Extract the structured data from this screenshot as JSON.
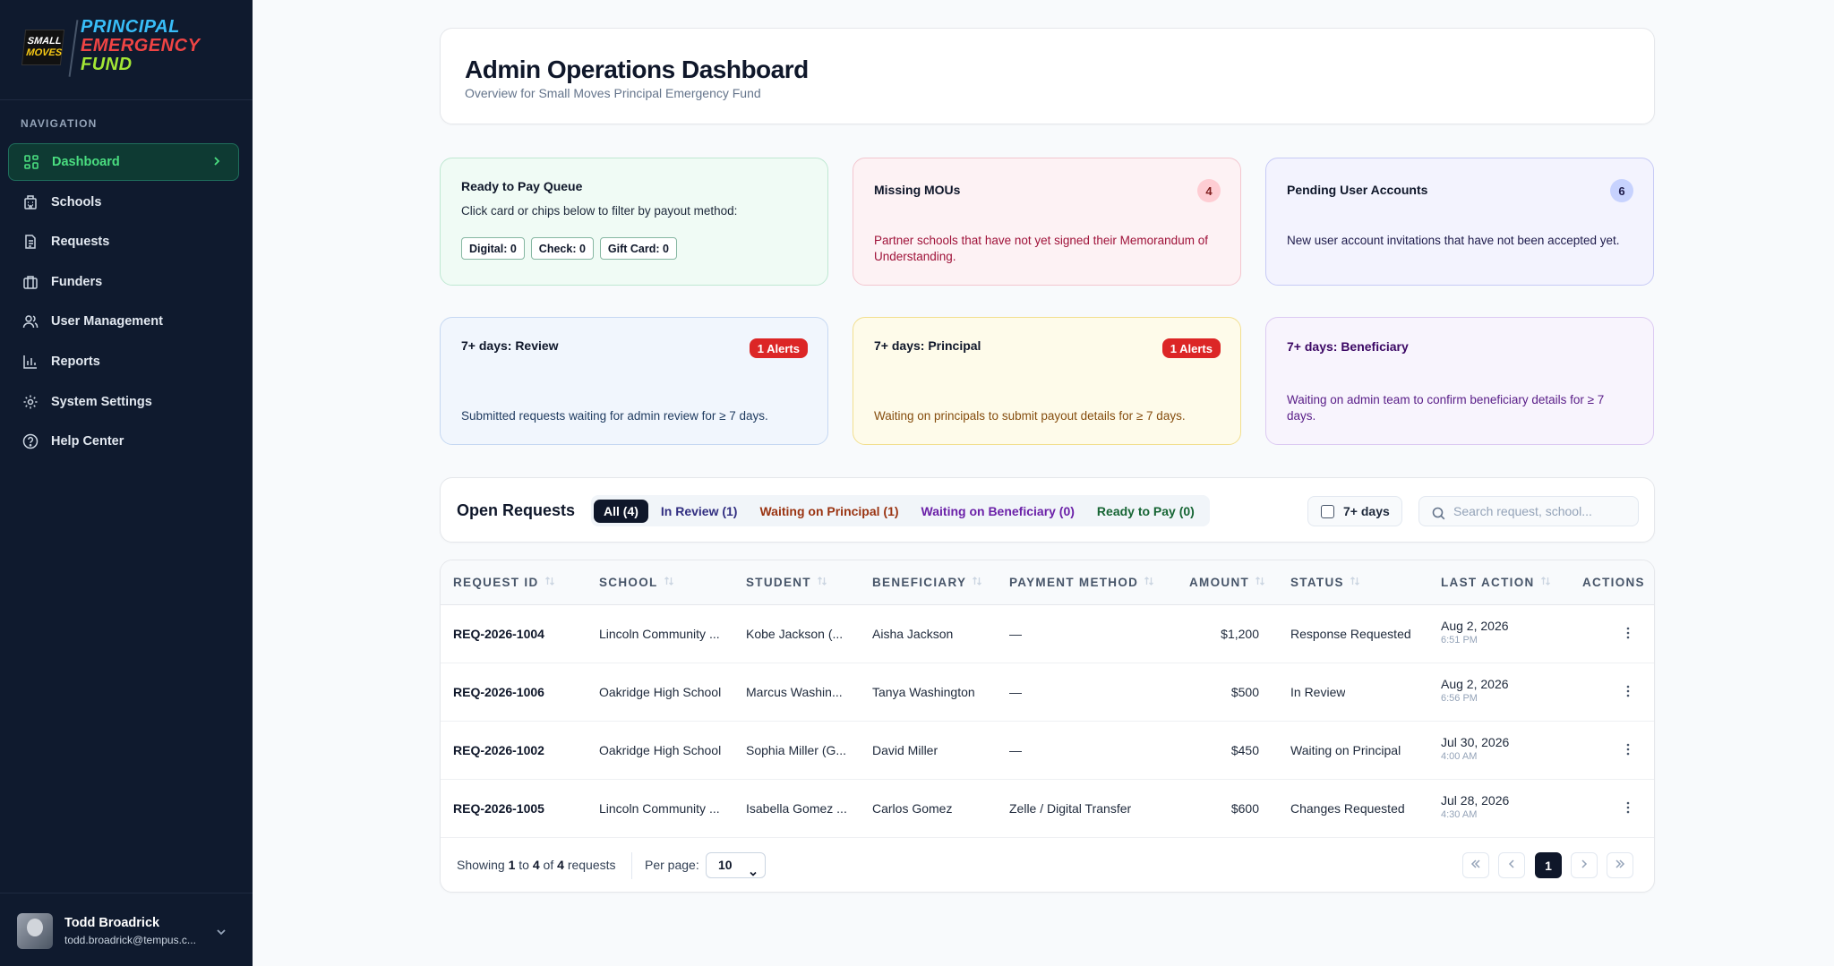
{
  "brand": {
    "badge_line1": "SMALL",
    "badge_line2": "MOVES",
    "line1": "PRINCIPAL",
    "line2": "EMERGENCY",
    "line3": "FUND"
  },
  "sidebar": {
    "heading": "NAVIGATION",
    "items": [
      {
        "label": "Dashboard",
        "icon": "grid-icon",
        "active": true
      },
      {
        "label": "Schools",
        "icon": "building-icon"
      },
      {
        "label": "Requests",
        "icon": "document-icon"
      },
      {
        "label": "Funders",
        "icon": "briefcase-icon"
      },
      {
        "label": "User Management",
        "icon": "users-icon"
      },
      {
        "label": "Reports",
        "icon": "bar-chart-icon"
      },
      {
        "label": "System Settings",
        "icon": "gear-icon"
      },
      {
        "label": "Help Center",
        "icon": "help-circle-icon"
      }
    ],
    "user": {
      "name": "Todd Broadrick",
      "email": "todd.broadrick@tempus.c..."
    }
  },
  "header": {
    "title": "Admin Operations Dashboard",
    "subtitle": "Overview for Small Moves Principal Emergency Fund"
  },
  "cards": {
    "ready": {
      "title": "Ready to Pay Queue",
      "desc": "Click card or chips below to filter by payout method:",
      "chips": [
        "Digital: 0",
        "Check: 0",
        "Gift Card: 0"
      ]
    },
    "mous": {
      "title": "Missing MOUs",
      "count": "4",
      "desc": "Partner schools that have not yet signed their Memorandum of Understanding."
    },
    "pending": {
      "title": "Pending User Accounts",
      "count": "6",
      "desc": "New user account invitations that have not been accepted yet."
    },
    "review": {
      "title": "7+ days: Review",
      "alert": "1 Alerts",
      "desc": "Submitted requests waiting for admin review for ≥ 7 days."
    },
    "principal": {
      "title": "7+ days: Principal",
      "alert": "1 Alerts",
      "desc": "Waiting on principals to submit payout details for ≥ 7 days."
    },
    "beneficiary": {
      "title": "7+ days: Beneficiary",
      "desc": "Waiting on admin team to confirm beneficiary details for ≥ 7 days."
    }
  },
  "open_requests": {
    "title": "Open Requests",
    "tabs": [
      "All (4)",
      "In Review (1)",
      "Waiting on Principal (1)",
      "Waiting on Beneficiary (0)",
      "Ready to Pay (0)"
    ],
    "seven_days_label": "7+ days",
    "search_placeholder": "Search request, school..."
  },
  "table": {
    "columns": [
      "REQUEST ID",
      "SCHOOL",
      "STUDENT",
      "BENEFICIARY",
      "PAYMENT METHOD",
      "AMOUNT",
      "STATUS",
      "LAST ACTION",
      "ACTIONS"
    ],
    "rows": [
      {
        "id": "REQ-2026-1004",
        "school": "Lincoln Community ...",
        "student": "Kobe Jackson (...",
        "beneficiary": "Aisha Jackson",
        "payment": "—",
        "amount": "$1,200",
        "status": "Response Requested",
        "date": "Aug 2, 2026",
        "time": "6:51 PM"
      },
      {
        "id": "REQ-2026-1006",
        "school": "Oakridge High School",
        "student": "Marcus Washin...",
        "beneficiary": "Tanya Washington",
        "payment": "—",
        "amount": "$500",
        "status": "In Review",
        "date": "Aug 2, 2026",
        "time": "6:56 PM"
      },
      {
        "id": "REQ-2026-1002",
        "school": "Oakridge High School",
        "student": "Sophia Miller (G...",
        "beneficiary": "David Miller",
        "payment": "—",
        "amount": "$450",
        "status": "Waiting on Principal",
        "date": "Jul 30, 2026",
        "time": "4:00 AM"
      },
      {
        "id": "REQ-2026-1005",
        "school": "Lincoln Community ...",
        "student": "Isabella Gomez ...",
        "beneficiary": "Carlos Gomez",
        "payment": "Zelle / Digital Transfer",
        "amount": "$600",
        "status": "Changes Requested",
        "date": "Jul 28, 2026",
        "time": "4:30 AM"
      }
    ]
  },
  "footer": {
    "showing_prefix": "Showing",
    "from": "1",
    "to_word": "to",
    "to": "4",
    "of_word": "of",
    "total": "4",
    "suffix": "requests",
    "per_page_label": "Per page:",
    "per_page_value": "10",
    "current_page": "1"
  }
}
